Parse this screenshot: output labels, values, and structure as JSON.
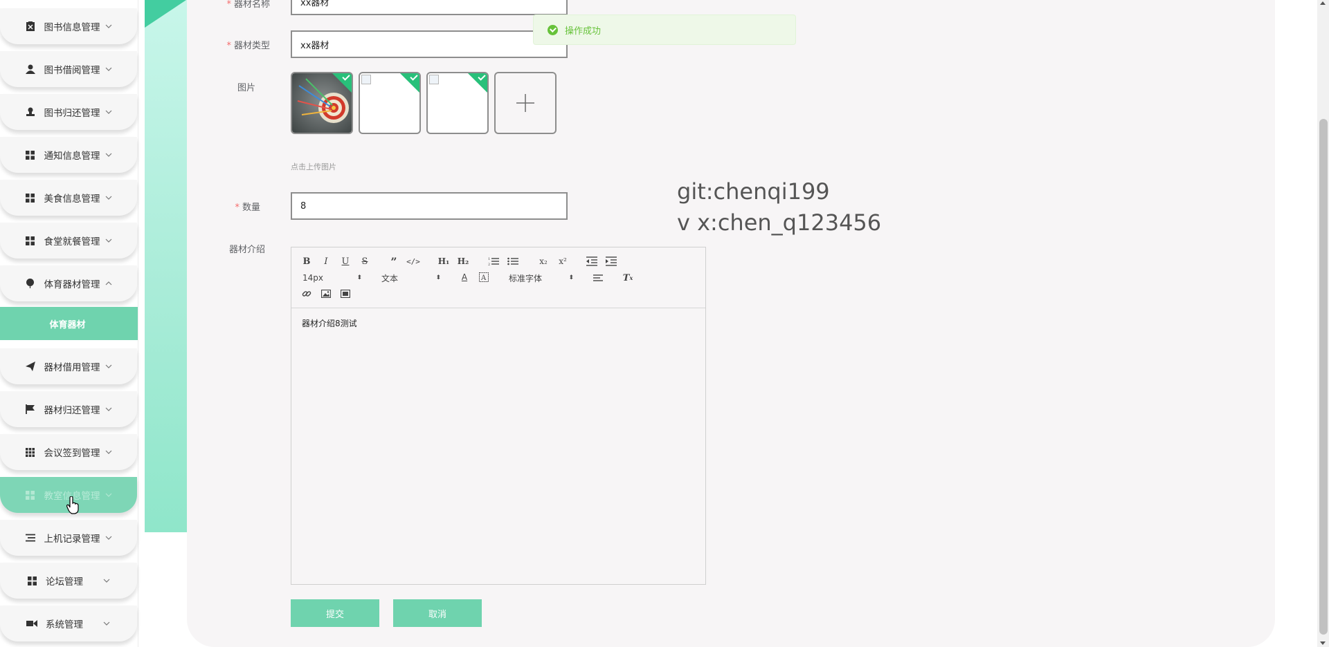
{
  "sidebar": {
    "items": [
      {
        "label": "图书信息管理",
        "icon": "book-icon"
      },
      {
        "label": "图书借阅管理",
        "icon": "user-icon"
      },
      {
        "label": "图书归还管理",
        "icon": "stamp-icon"
      },
      {
        "label": "通知信息管理",
        "icon": "grid-icon"
      },
      {
        "label": "美食信息管理",
        "icon": "grid-icon"
      },
      {
        "label": "食堂就餐管理",
        "icon": "grid-icon"
      },
      {
        "label": "体育器材管理",
        "icon": "balloon-icon"
      },
      {
        "label": "器材借用管理",
        "icon": "paper-plane-icon"
      },
      {
        "label": "器材归还管理",
        "icon": "flag-icon"
      },
      {
        "label": "会议签到管理",
        "icon": "grid-nine-icon"
      },
      {
        "label": "教室信息管理",
        "icon": "grid-icon"
      },
      {
        "label": "上机记录管理",
        "icon": "list-icon"
      },
      {
        "label": "论坛管理",
        "icon": "grid-icon"
      },
      {
        "label": "系统管理",
        "icon": "video-icon"
      }
    ],
    "sub_item": "体育器材"
  },
  "form": {
    "name_label": "器材名称",
    "name_value": "xx器材",
    "type_label": "器材类型",
    "type_value": "xx器材",
    "image_label": "图片",
    "upload_hint": "点击上传图片",
    "quantity_label": "数量",
    "quantity_value": "8",
    "intro_label": "器材介绍"
  },
  "editor": {
    "font_size": "14px",
    "heading_picker": "文本",
    "font_family": "标准字体",
    "content": "器材介绍8测试"
  },
  "buttons": {
    "submit": "提交",
    "cancel": "取消"
  },
  "toast": {
    "message": "操作成功"
  },
  "watermark": {
    "line1": "git:chenqi199",
    "line2": "v x:chen_q123456"
  },
  "colors": {
    "accent": "#6fd3ae",
    "success": "#67c23a",
    "required": "#f56c6c"
  }
}
